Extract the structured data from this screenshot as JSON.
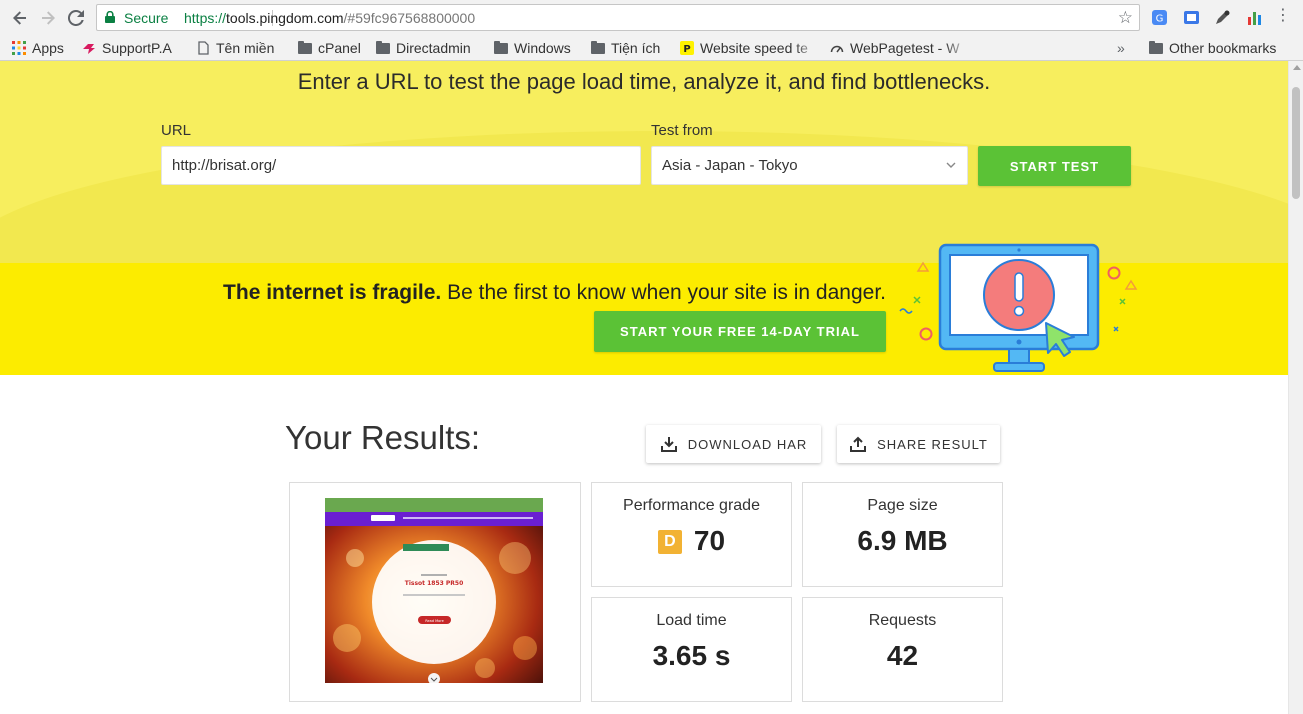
{
  "browser": {
    "secure_label": "Secure",
    "url_scheme": "https://",
    "url_host": "tools.pingdom.com",
    "url_rest": "/#59fc967568800000",
    "bookmarks": [
      {
        "label": "Apps"
      },
      {
        "label": "SupportP.A"
      },
      {
        "label": "Tên miền"
      },
      {
        "label": "cPanel"
      },
      {
        "label": "Directadmin"
      },
      {
        "label": "Windows"
      },
      {
        "label": "Tiện ích"
      },
      {
        "label": "Website speed te"
      },
      {
        "label": "WebPagetest - W"
      }
    ],
    "overflow_label": "»",
    "other_bookmarks": "Other bookmarks"
  },
  "hero": {
    "title": "Enter a URL to test the page load time, analyze it, and find bottlenecks.",
    "url_label": "URL",
    "url_value": "http://brisat.org/",
    "test_from_label": "Test from",
    "test_from_value": "Asia - Japan - Tokyo",
    "start_test": "START TEST"
  },
  "banner": {
    "bold_text": "The internet is fragile.",
    "rest_text": " Be the first to know when your site is in danger.",
    "trial_button": "START YOUR FREE 14-DAY TRIAL"
  },
  "results": {
    "title": "Your Results:",
    "download_har": "DOWNLOAD HAR",
    "share_result": "SHARE RESULT",
    "performance_grade_label": "Performance grade",
    "performance_grade_letter": "D",
    "performance_grade_value": "70",
    "page_size_label": "Page size",
    "page_size_value": "6.9 MB",
    "load_time_label": "Load time",
    "load_time_value": "3.65 s",
    "requests_label": "Requests",
    "requests_value": "42"
  },
  "thumbnail": {
    "title": "Tissot 1853 PR50",
    "button": "Read More"
  },
  "colors": {
    "hero_bg": "#f7ee5e",
    "banner_bg": "#fcec00",
    "green": "#5bc236",
    "grade_orange": "#f2b233",
    "secure_green": "#0b8043"
  }
}
